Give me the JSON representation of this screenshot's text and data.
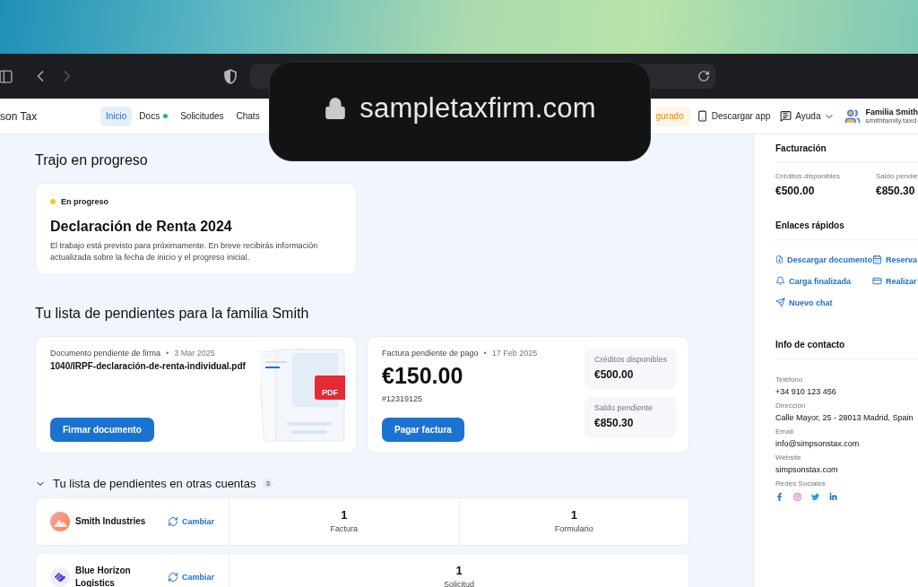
{
  "browser": {
    "url": "sampletaxfirm.com"
  },
  "app_nav": {
    "brand": "son Tax",
    "tabs": [
      {
        "label": "Inicio",
        "selected": true,
        "dot": false
      },
      {
        "label": "Docs",
        "selected": false,
        "dot": true
      },
      {
        "label": "Solicitudes",
        "selected": false,
        "dot": false
      },
      {
        "label": "Chats",
        "selected": false,
        "dot": false
      }
    ],
    "badge": "gurado",
    "download": "Descargar app",
    "help": "Ayuda",
    "user": {
      "name": "Familia Smith",
      "email": "smithfamily.taxd"
    }
  },
  "in_progress": {
    "title": "Trajo en progreso",
    "status": "En progreso",
    "heading": "Declaración de Renta 2024",
    "text": "El trabajo está previsto para próximamente. En breve recibirás información actualizada sobre la fecha de inicio y el progreso inicial."
  },
  "todo": {
    "title": "Tu lista de pendientes para la familia Smith",
    "document": {
      "label": "Documento pendiente de firma",
      "separator": "•",
      "date": "3 Mar 2025",
      "file": "1040/IRPF-declaración-de-renta-individual.pdf",
      "badge": "PDF",
      "button": "Firmar documento"
    },
    "invoice": {
      "label": "Factura pendiente de pago",
      "separator": "•",
      "date": "17 Feb 2025",
      "amount": "€150.00",
      "number": "#12319125",
      "button": "Pagar factura",
      "stats": [
        {
          "label": "Créditos disponibles",
          "value": "€500.00"
        },
        {
          "label": "Saldo pendiente",
          "value": "€850.30"
        }
      ]
    }
  },
  "other_accounts": {
    "title": "Tu lista de pendientes en otras cuentas",
    "count": "3",
    "expanded": true,
    "accounts": [
      {
        "name": "Smith Industries",
        "action": "Cambiar",
        "items": [
          {
            "count": "1",
            "label": "Factura"
          },
          {
            "count": "1",
            "label": "Formulario"
          }
        ]
      },
      {
        "name": "Blue Horizon Logistics",
        "action": "Cambiar",
        "items": [
          {
            "count": "1",
            "label": "Solicitud"
          }
        ]
      }
    ]
  },
  "sidebar": {
    "billing": {
      "title": "Facturación",
      "stats": [
        {
          "label": "Créditos disponibles",
          "value": "€500.00"
        },
        {
          "label": "Saldo pendie",
          "value": "€850.30"
        }
      ]
    },
    "quick_links": {
      "title": "Enlaces rápidos",
      "links": [
        "Descargar documento",
        "Reserva",
        "Carga finalizada",
        "Realizar",
        "Nuevo chat"
      ]
    },
    "contact": {
      "title": "Info de contacto",
      "fields": [
        {
          "label": "Teléfono",
          "value": "+34 910 123 456"
        },
        {
          "label": "Dirección",
          "value": "Calle Mayor, 25 - 28013 Madrid, Spain"
        },
        {
          "label": "Email",
          "value": "info@simpsonstax.com"
        },
        {
          "label": "Website",
          "value": "simpsonstax.com"
        }
      ],
      "social_label": "Redes Sociales"
    }
  }
}
